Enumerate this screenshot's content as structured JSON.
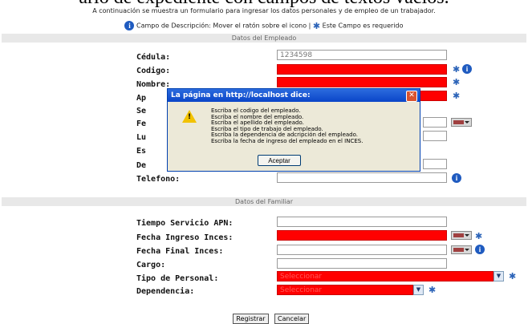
{
  "caption": "ario de expediente con campos de textos vacíos.",
  "intro": "A continuación se muestra un formulario para ingresar los datos personales y de empleo de un trabajador.",
  "legend": {
    "info_text": "Campo de Descripción: Mover el ratón sobre el icono |",
    "required_text": "Este Campo es requerido"
  },
  "employee_section": {
    "title": "Datos del Empleado",
    "labels": {
      "cedula": "Cédula:",
      "codigo": "Codigo:",
      "nombre": "Nombre:",
      "apellido": "Ap",
      "se": "Se",
      "fe": "Fe",
      "lu": "Lu",
      "es": "Es",
      "de": "De",
      "telefono": "Telefono:"
    },
    "cedula_value": "1234598"
  },
  "family_section": {
    "title": "Datos del Familiar",
    "labels": {
      "tiempo": "Tiempo Servicio APN:",
      "ingreso": "Fecha Ingreso Inces:",
      "final": "Fecha Final Inces:",
      "cargo": "Cargo:",
      "tipo": "Tipo de Personal:",
      "dependencia": "Dependencia:"
    },
    "tipo_placeholder": "Seleccionar",
    "dependencia_placeholder": "Seleccionar"
  },
  "buttons": {
    "registrar": "Registrar",
    "cancelar": "Cancelar"
  },
  "dialog": {
    "title": "La página en http://localhost dice:",
    "close": "✕",
    "lines": [
      "Escriba el codigo del empleado.",
      "Escriba el  nombre del empleado.",
      "Escriba el apellido del empleado.",
      "Escriba el tipo de trabajo del empleado.",
      "Escriba la dependencia de adcripción del empleado.",
      "Escriba la fecha de ingreso del empleado en el INCES."
    ],
    "ok": "Aceptar"
  },
  "icons": {
    "info": "info-icon",
    "required": "asterisk-icon",
    "warning": "warning-icon",
    "calendar": "calendar-icon"
  },
  "colors": {
    "required_field": "#ff0000",
    "section_header": "#e8e8e8",
    "dialog_title": "#0a45c8"
  }
}
